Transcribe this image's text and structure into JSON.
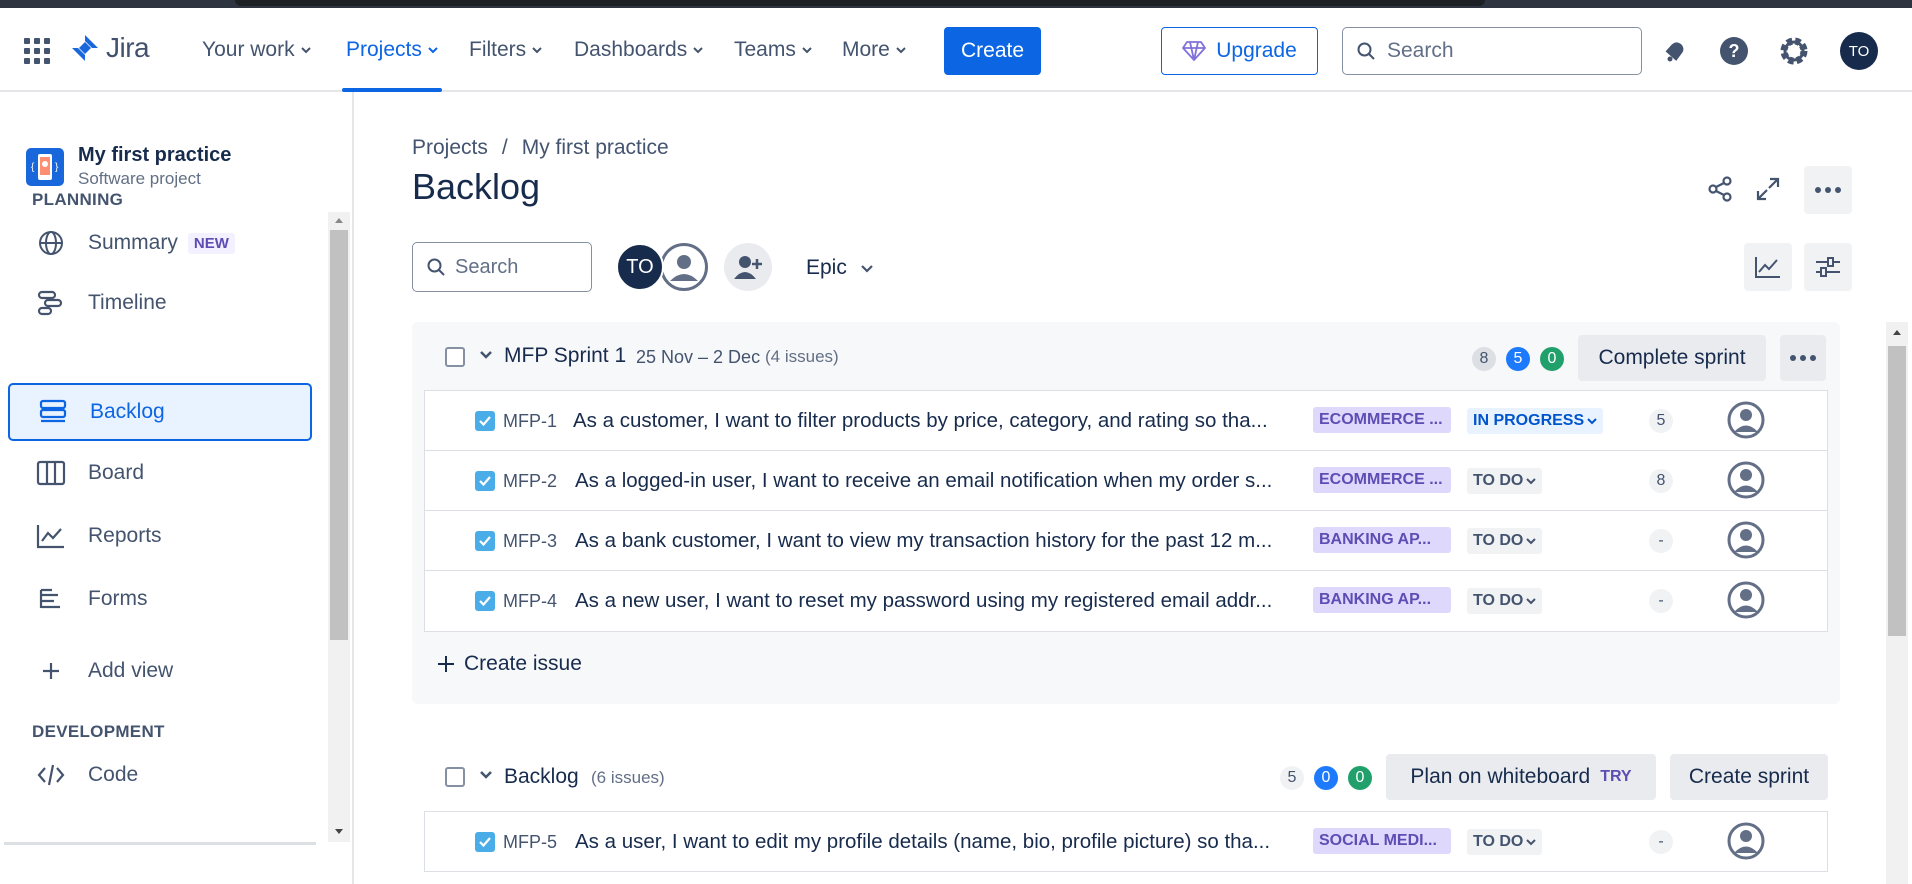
{
  "nav": {
    "logo": "Jira",
    "items": [
      {
        "label": "Your work"
      },
      {
        "label": "Projects"
      },
      {
        "label": "Filters"
      },
      {
        "label": "Dashboards"
      },
      {
        "label": "Teams"
      },
      {
        "label": "More"
      }
    ],
    "create_label": "Create",
    "upgrade_label": "Upgrade",
    "search_placeholder": "Search",
    "user_initials": "TO"
  },
  "sidebar": {
    "project_name": "My first practice",
    "project_type": "Software project",
    "planning_heading": "PLANNING",
    "items": [
      {
        "label": "Summary",
        "badge": "NEW"
      },
      {
        "label": "Timeline"
      },
      {
        "label": "Backlog"
      },
      {
        "label": "Board"
      },
      {
        "label": "Reports"
      },
      {
        "label": "Forms"
      },
      {
        "label": "Add view"
      }
    ],
    "development_heading": "DEVELOPMENT",
    "dev_items": [
      {
        "label": "Code"
      }
    ]
  },
  "main": {
    "breadcrumb": [
      "Projects",
      "/",
      "My first practice"
    ],
    "title": "Backlog",
    "filter_search_placeholder": "Search",
    "avatar_initials": "TO",
    "epic_label": "Epic"
  },
  "sprint": {
    "name": "MFP Sprint 1",
    "dates": "25 Nov – 2 Dec",
    "issue_count": "(4 issues)",
    "counts": {
      "todo": "8",
      "in_progress": "5",
      "done": "0"
    },
    "complete_label": "Complete sprint",
    "create_issue_label": "Create issue",
    "issues": [
      {
        "key": "MFP-1",
        "summary": "As a customer, I want to filter products by price, category, and rating so tha...",
        "epic": "ECOMMERCE ...",
        "status": "IN PROGRESS",
        "estimate": "5"
      },
      {
        "key": "MFP-2",
        "summary": "As a logged-in user, I want to receive an email notification when my order s...",
        "epic": "ECOMMERCE ...",
        "status": "TO DO",
        "estimate": "8"
      },
      {
        "key": "MFP-3",
        "summary": "As a bank customer, I want to view my transaction history for the past 12 m...",
        "epic": "BANKING AP...",
        "status": "TO DO",
        "estimate": "-"
      },
      {
        "key": "MFP-4",
        "summary": "As a new user, I want to reset my password using my registered email addr...",
        "epic": "BANKING AP...",
        "status": "TO DO",
        "estimate": "-"
      }
    ]
  },
  "backlog": {
    "name": "Backlog",
    "issue_count": "(6 issues)",
    "counts": {
      "todo": "5",
      "in_progress": "0",
      "done": "0"
    },
    "plan_label": "Plan on whiteboard",
    "try_badge": "TRY",
    "create_sprint_label": "Create sprint",
    "issues": [
      {
        "key": "MFP-5",
        "summary": "As a user, I want to edit my profile details (name, bio, profile picture) so tha...",
        "epic": "SOCIAL MEDI...",
        "status": "TO DO",
        "estimate": "-"
      }
    ]
  },
  "colors": {
    "brand": "#0C66E4",
    "epic_bg": "#DFD8FD",
    "epic_text": "#5E4DB2",
    "in_progress": "#1D7AFC",
    "done": "#22A06B"
  }
}
